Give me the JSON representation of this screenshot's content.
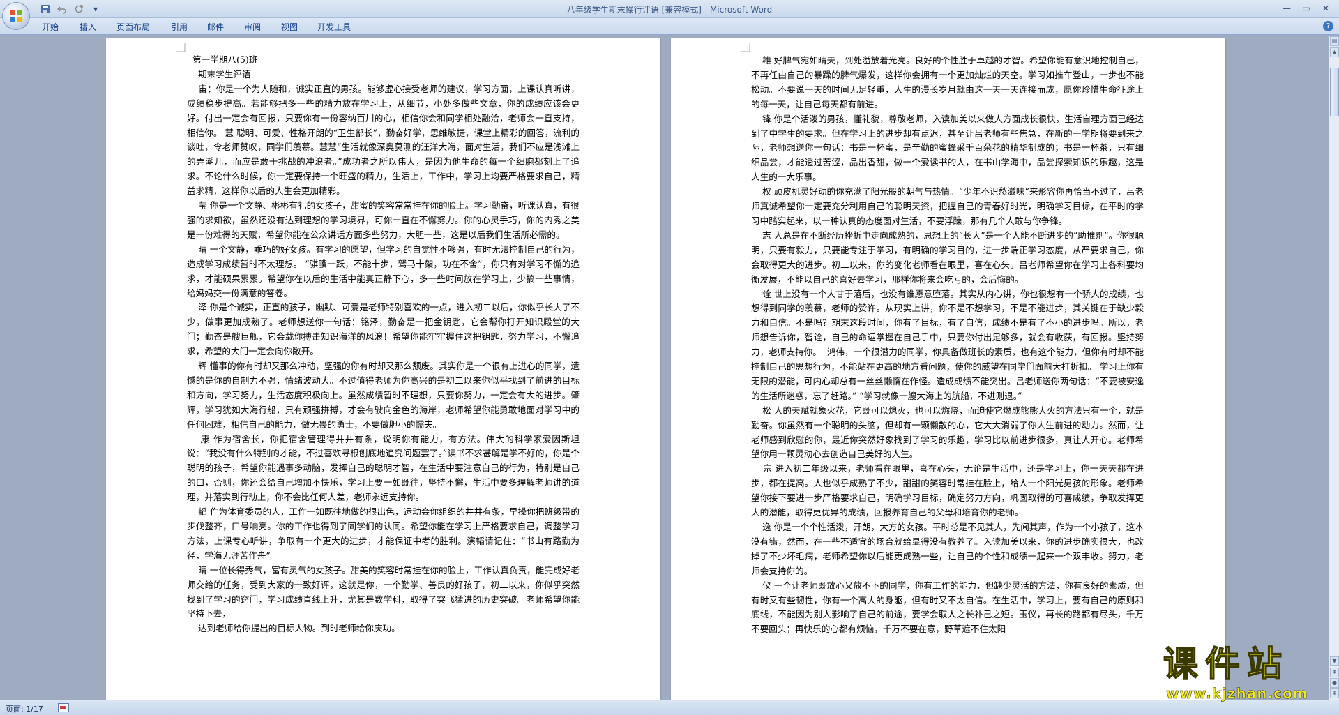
{
  "window": {
    "title": "八年级学生期末操行评语 [兼容模式] - Microsoft Word",
    "controls": {
      "minimize_icon": "minimize-icon",
      "maximize_icon": "maximize-icon",
      "close_icon": "close-icon"
    }
  },
  "quick_access": {
    "save_icon": "save-icon",
    "undo_icon": "undo-icon",
    "redo_icon": "redo-icon",
    "customize_icon": "dropdown-icon"
  },
  "ribbon": {
    "tabs": [
      "开始",
      "插入",
      "页面布局",
      "引用",
      "邮件",
      "审阅",
      "视图",
      "开发工具"
    ],
    "help_label": "?"
  },
  "document": {
    "page_left": {
      "text": "  第一学期八(5)班\n    期末学生评语\n    宙：你是一个为人随和，诚实正直的男孩。能够虚心接受老师的建议，学习方面，上课认真听讲，成绩稳步提高。若能够把多一些的精力放在学习上，从细节，小处多做些文章，你的成绩应该会更好。付出一定会有回报，只要你有一份容纳百川的心，相信你会和同学相处融洽，老师会一直支持，相信你。 慧 聪明、可爱、性格开朗的“卫生部长”，勤奋好学，思维敏捷，课堂上精彩的回答，流利的谈吐，令老师赞叹，同学们羡慕。慧慧“生活就像深奥莫测的汪洋大海，面对生活，我们不应是浅滩上的弄潮儿，而应是敢于挑战的冲浪者。”成功者之所以伟大，是因为他生命的每一个细胞都刻上了追求。不论什么时候，你一定要保持一个旺盛的精力，生活上，工作中，学习上均要严格要求自己，精益求精，这样你以后的人生会更加精彩。\n    莹 你是一个文静、彬彬有礼的女孩子，甜蜜的笑容常常挂在你的脸上。学习勤奋，听课认真，有很强的求知欲，虽然还没有达到理想的学习境界，可你一直在不懈努力。你的心灵手巧，你的内秀之美是一份难得的天赋，希望你能在公众讲话方面多些努力，大胆一些，这是以后我们生活所必需的。\n    晴 一个文静，乖巧的好女孩。有学习的愿望，但学习的自觉性不够强，有时无法控制自己的行为，造成学习成绩暂时不太理想。 “骐骥一跃，不能十步，驽马十架，功在不舍”，你只有对学习不懈的追求，才能硕果累累。希望你在以后的生活中能真正静下心，多一些时间放在学习上，少搞一些事情，给妈妈交一份满意的答卷。\n    泽 你是个诚实，正直的孩子，幽默、可爱是老师特别喜欢的一点，进入初二以后，你似乎长大了不少，做事更加成熟了。老师想送你一句话：铭泽，勤奋是一把金钥匙，它会帮你打开知识殿堂的大门；勤奋是艘巨舰，它会载你搏击知识海洋的风浪！希望你能牢牢握住这把钥匙，努力学习，不懈追求，希望的大门一定会向你敞开。\n    辉 懂事的你有时却又那么冲动，坚强的你有时却又那么颓废。其实你是一个很有上进心的同学，遗憾的是你的自制力不强，情绪波动大。不过值得老师为你高兴的是初二以来你似乎找到了前进的目标和方向，学习努力，生活态度积极向上。虽然成绩暂时不理想，只要你努力，一定会有大的进步。肇辉，学习犹如大海行船，只有顽强拼搏，才会有驶向金色的海岸，老师希望你能勇敢地面对学习中的任何困难，相信自己的能力，做无畏的勇士，不要做胆小的懦夫。\n    康 作为宿舍长，你把宿舍管理得井井有条，说明你有能力，有方法。伟大的科学家爱因斯坦说：“我没有什么特别的才能，不过喜欢寻根刨底地追究问题罢了。”读书不求甚解是学不好的，你是个聪明的孩子，希望你能遇事多动脑，发挥自己的聪明才智，在生活中要注意自己的行为，特别是自己的口，否则，你还会给自己增加不快乐，学习上要一如既往，坚持不懈，生活中要多理解老师讲的道理，并落实到行动上，你不会比任何人差，老师永远支持你。\n    韬 作为体育委员的人，工作一如既往地做的很出色，运动会你组织的井井有条，早操你把班级带的步伐整齐，口号响亮。你的工作也得到了同学们的认同。希望你能在学习上严格要求自己，调整学习方法，上课专心听讲，争取有一个更大的进步，才能保证中考的胜利。演韬请记住：“书山有路勤为径，学海无涯苦作舟”。\n    晴 一位长得秀气，富有灵气的女孩子。甜美的笑容时常挂在你的脸上，工作认真负责，能完成好老师交给的任务，受到大家的一致好评，这就是你，一个勤学、善良的好孩子，初二以来，你似乎突然找到了学习的窍门，学习成绩直线上升，尤其是数学科，取得了突飞猛进的历史突破。老师希望你能坚持下去，\n    达到老师给你提出的目标人物。到时老师给你庆功。"
    },
    "page_right": {
      "text": "    雄 好脾气宛如晴天，到处溢放着光亮。良好的个性胜于卓越的才智。希望你能有意识地控制自己，不再任由自己的暴躁的脾气爆发，这样你会拥有一个更加灿烂的天空。学习如推车登山，一步也不能松动。不要说一天的时间无足轻重，人生的漫长岁月就由这一天一天连接而成，愿你珍惜生命征途上的每一天，让自己每天都有前进。\n    锋 你是个活泼的男孩，懂礼貌，尊敬老师，入读加美以来做人方面成长很快，生活自理方面已经达到了中学生的要求。但在学习上的进步却有点迟，甚至让吕老师有些焦急，在新的一学期将要到来之际，老师想送你一句话：书是一杯蜜，是辛勤的蜜蜂采千百朵花的精华制成的；书是一杯茶，只有细细品尝，才能透过苦涩，品出香甜，做一个爱读书的人，在书山学海中，品尝探索知识的乐趣，这是人生的一大乐事。\n    权 顽皮机灵好动的你充满了阳光般的朝气与热情。“少年不识愁滋味”来形容你再恰当不过了，吕老师真诚希望你一定要充分利用自己的聪明天资，把握自己的青春好时光，明确学习目标，在平时的学习中踏实起来，以一种认真的态度面对生活，不要浮躁，那有几个人敢与你争锋。\n    志 人总是在不断经历挫折中走向成熟的，思想上的“长大”是一个人能不断进步的“助推剂”。你很聪明，只要有毅力，只要能专注于学习，有明确的学习目的，进一步端正学习态度，从严要求自己，你会取得更大的进步。初二以来，你的变化老师看在眼里，喜在心头。吕老师希望你在学习上各科要均衡发展，不能以自己的喜好去学习，那样你将来会吃亏的，会后悔的。\n    诠 世上没有一个人甘于落后，也没有谁愿意堕落。其实从内心讲，你也很想有一个骄人的成绩，也想得到同学的羡慕，老师的赞许。从现实上讲，你不是不想学习，不是不能进步，其关键在于缺少毅力和自信。不是吗？期末这段时间，你有了目标，有了自信，成绩不是有了不小的进步吗。所以，老师想告诉你，智诠，自己的命运掌握在自己手中，只要你付出足够多，就会有收获，有回报。坚持努力，老师支持你。  鸿伟，一个很潜力的同学，你具备做班长的素质，也有这个能力，但你有时却不能控制自己的思想行为，不能站在更高的地方看问题，使你的威望在同学们面前大打折扣。 学习上你有无限的潜能，可内心却总有一丝丝懒惰在作怪。造成成绩不能突出。吕老师送你两句话：“不要被安逸的生活所迷惑，忘了赶路。” “学习就像一艘大海上的航船，不进则退。”\n    松 人的天赋就象火花，它既可以熄灭，也可以燃烧，而迫使它燃成熊熊大火的方法只有一个，就是勤奋。你虽然有一个聪明的头脑，但却有一颗懒散的心，它大大消弱了你人生前进的动力。然而，让老师感到欣慰的你，最近你突然好象找到了学习的乐趣，学习比以前进步很多，真让人开心。老师希望你用一颗灵动心去创造自己美好的人生。\n    宗 进入初二年级以来，老师看在眼里，喜在心头，无论是生活中，还是学习上，你一天天都在进步，都在提高。人也似乎成熟了不少，甜甜的笑容时常挂在脸上，给人一个阳光男孩的形象。老师希望你接下要进一步严格要求自己，明确学习目标，确定努力方向，巩固取得的可喜成绩，争取发挥更大的潜能，取得更优异的成绩，回报养育自己的父母和培育你的老师。\n    逸 你是一个个性活泼，开朗，大方的女孩。平时总是不见其人，先闻其声，作为一个小孩子，这本没有错，然而，在一些不适宜的场合就给显得没有教养了。入读加美以来，你的进步确实很大，也改掉了不少坏毛病，老师希望你以后能更成熟一些，让自己的个性和成绩一起来一个双丰收。努力，老师会支持你的。\n    仪 一个让老师既放心又放不下的同学，你有工作的能力，但缺少灵活的方法，你有良好的素质，但有时又有些韧性，你有一个高大的身躯，但有时又不太自信。在生活中，学习上，要有自己的原则和底线，不能因为别人影响了自己的前途，要学会取人之长补己之短。玉仪，再长的路都有尽头，千万不要回头；再快乐的心都有烦恼，千万不要在意，野草遮不住太阳"
    }
  },
  "statusbar": {
    "page_label": "页面: 1/17",
    "proofing_icon": "proofing-icon"
  },
  "watermark": {
    "title": "课件站",
    "url": "www.kjzhan.com"
  },
  "colors": {
    "title_text": "#3d5a88",
    "tab_text": "#15428b",
    "doc_background": "#9eabc0",
    "watermark": "#f2ea1b"
  }
}
